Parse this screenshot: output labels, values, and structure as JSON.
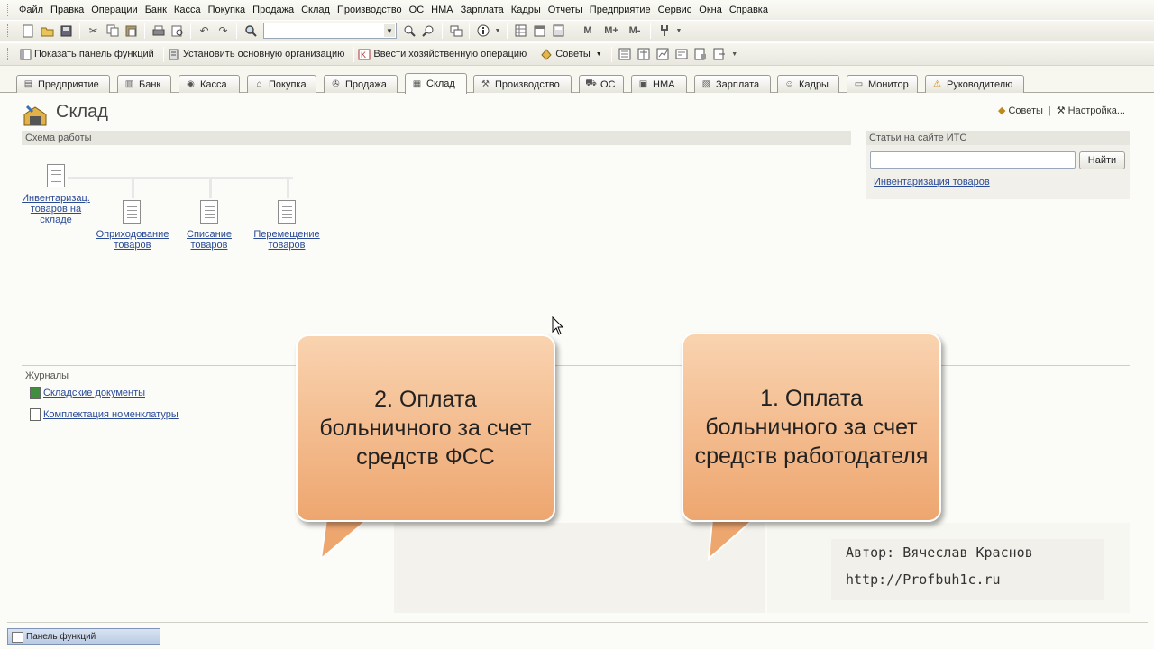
{
  "menubar": {
    "items": [
      "Файл",
      "Правка",
      "Операции",
      "Банк",
      "Касса",
      "Покупка",
      "Продажа",
      "Склад",
      "Производство",
      "ОС",
      "НМА",
      "Зарплата",
      "Кадры",
      "Отчеты",
      "Предприятие",
      "Сервис",
      "Окна",
      "Справка"
    ]
  },
  "toolbar2": {
    "show_panel": "Показать панель функций",
    "set_org": "Установить основную организацию",
    "enter_op": "Ввести хозяйственную операцию",
    "tips": "Советы"
  },
  "tabs": [
    "Предприятие",
    "Банк",
    "Касса",
    "Покупка",
    "Продажа",
    "Склад",
    "Производство",
    "ОС",
    "НМА",
    "Зарплата",
    "Кадры",
    "Монитор",
    "Руководителю"
  ],
  "page": {
    "title": "Склад",
    "tips_link": "Советы",
    "settings_link": "Настройка..."
  },
  "scheme": {
    "header": "Схема работы",
    "root": "Инвентаризац. товаров на складе",
    "children": [
      "Оприходование товаров",
      "Списание товаров",
      "Перемещение товаров"
    ]
  },
  "its": {
    "header": "Статьи на сайте ИТС",
    "search_value": "",
    "find_button": "Найти",
    "link": "Инвентаризация товаров"
  },
  "journals": {
    "header": "Журналы",
    "items": [
      "Складские документы",
      "Комплектация номенклатуры"
    ]
  },
  "callouts": {
    "first": "1. Оплата больничного за счет средств работодателя",
    "second": "2. Оплата больничного за счет средств ФСС"
  },
  "author": {
    "line1": "Автор: Вячеслав Краснов",
    "line2": "http://Profbuh1c.ru"
  },
  "statusbar": {
    "panel": "Панель функций"
  },
  "colors": {
    "callout": "#eea66f",
    "link": "#2a4a96"
  }
}
